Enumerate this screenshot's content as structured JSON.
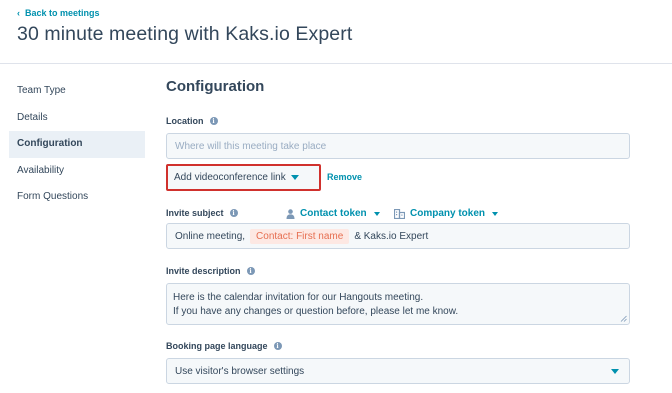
{
  "header": {
    "back_label": "Back to meetings",
    "title": "30 minute meeting with Kaks.io Expert"
  },
  "sidebar": {
    "items": [
      {
        "label": "Team Type"
      },
      {
        "label": "Details"
      },
      {
        "label": "Configuration",
        "active": true
      },
      {
        "label": "Availability"
      },
      {
        "label": "Form Questions"
      }
    ]
  },
  "main": {
    "section_title": "Configuration",
    "location": {
      "label": "Location",
      "placeholder": "Where will this meeting take place",
      "video_button_label": "Add videoconference link",
      "remove_label": "Remove"
    },
    "invite_subject": {
      "label": "Invite subject",
      "contact_token_label": "Contact token",
      "company_token_label": "Company token",
      "prefix": "Online meeting,",
      "token": "Contact: First name",
      "suffix": "& Kaks.io Expert"
    },
    "invite_description": {
      "label": "Invite description",
      "line1": "Here is the calendar invitation for our Hangouts meeting.",
      "line2": "If you have any changes or question before, please let me know."
    },
    "booking_language": {
      "label": "Booking page language",
      "value": "Use visitor's browser settings"
    }
  },
  "colors": {
    "link": "#0091ae",
    "highlight_border": "#d0312d",
    "token_bg": "#fde8e3",
    "token_text": "#e66e50",
    "text": "#33475b"
  }
}
